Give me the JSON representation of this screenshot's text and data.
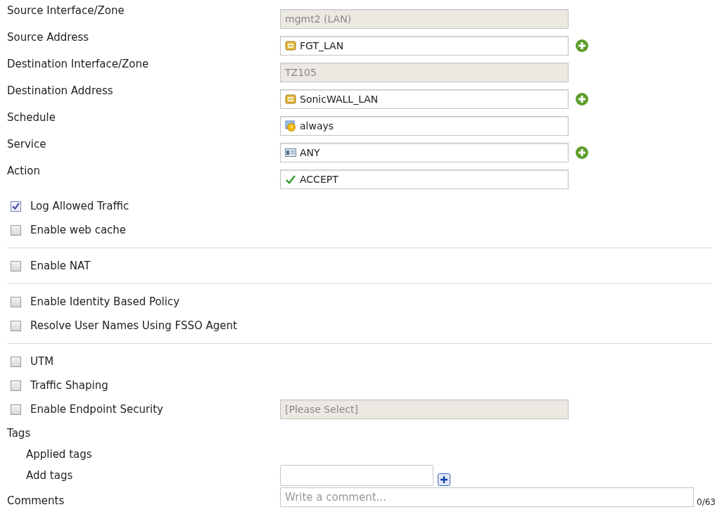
{
  "fields": [
    {
      "label": "Source Interface/Zone",
      "value": "mgmt2 (LAN)",
      "kind": "readonly",
      "add": false
    },
    {
      "label": "Source Address",
      "value": "FGT_LAN",
      "kind": "address",
      "add": true
    },
    {
      "label": "Destination Interface/Zone",
      "value": "TZ105",
      "kind": "readonly",
      "add": false
    },
    {
      "label": "Destination Address",
      "value": "SonicWALL_LAN",
      "kind": "address",
      "add": true
    },
    {
      "label": "Schedule",
      "value": "always",
      "kind": "schedule",
      "add": false
    },
    {
      "label": "Service",
      "value": "ANY",
      "kind": "service",
      "add": true
    },
    {
      "label": "Action",
      "value": "ACCEPT",
      "kind": "action",
      "add": false
    }
  ],
  "sections": [
    [
      {
        "label": "Log Allowed Traffic",
        "checked": true
      },
      {
        "label": "Enable web cache",
        "checked": false
      }
    ],
    [
      {
        "label": "Enable NAT",
        "checked": false
      }
    ],
    [
      {
        "label": "Enable Identity Based Policy",
        "checked": false
      },
      {
        "label": "Resolve User Names Using FSSO Agent",
        "checked": false
      }
    ],
    [
      {
        "label": "UTM",
        "checked": false
      },
      {
        "label": "Traffic Shaping",
        "checked": false
      },
      {
        "label": "Enable Endpoint Security",
        "checked": false,
        "select": {
          "placeholder": "[Please Select]",
          "disabled": true
        }
      }
    ]
  ],
  "tags": {
    "label": "Tags",
    "applied_label": "Applied tags",
    "add_label": "Add tags"
  },
  "comments": {
    "label": "Comments",
    "placeholder": "Write a comment...",
    "counter": "0/63"
  }
}
